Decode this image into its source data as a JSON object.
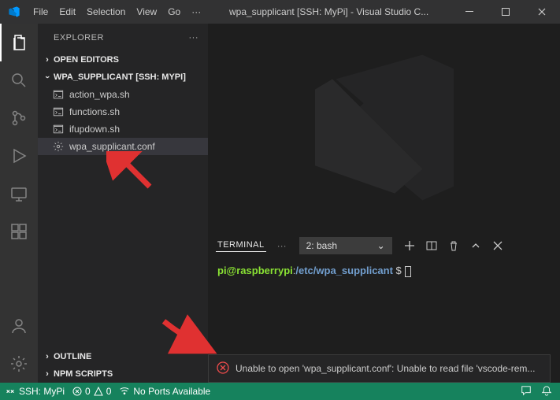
{
  "titlebar": {
    "menu": [
      "File",
      "Edit",
      "Selection",
      "View",
      "Go"
    ],
    "menu_overflow": "···",
    "title": "wpa_supplicant [SSH: MyPi] - Visual Studio C..."
  },
  "sidebar": {
    "header": "EXPLORER",
    "sections": {
      "open_editors": "OPEN EDITORS",
      "workspace": "WPA_SUPPLICANT [SSH: MYPI]",
      "outline": "OUTLINE",
      "npm_scripts": "NPM SCRIPTS"
    },
    "files": [
      {
        "name": "action_wpa.sh",
        "icon": "shell"
      },
      {
        "name": "functions.sh",
        "icon": "shell"
      },
      {
        "name": "ifupdown.sh",
        "icon": "shell"
      },
      {
        "name": "wpa_supplicant.conf",
        "icon": "gear",
        "selected": true
      }
    ]
  },
  "panel": {
    "tab": "TERMINAL",
    "overflow": "···",
    "dropdown": "2: bash",
    "prompt_user": "pi@raspberrypi",
    "prompt_sep": ":",
    "prompt_path": "/etc/wpa_supplicant",
    "prompt_sym": " $"
  },
  "notification": {
    "text": "Unable to open 'wpa_supplicant.conf': Unable to read file 'vscode-rem..."
  },
  "statusbar": {
    "remote": "SSH: MyPi",
    "errors": "0",
    "warnings": "0",
    "ports": "No Ports Available"
  }
}
